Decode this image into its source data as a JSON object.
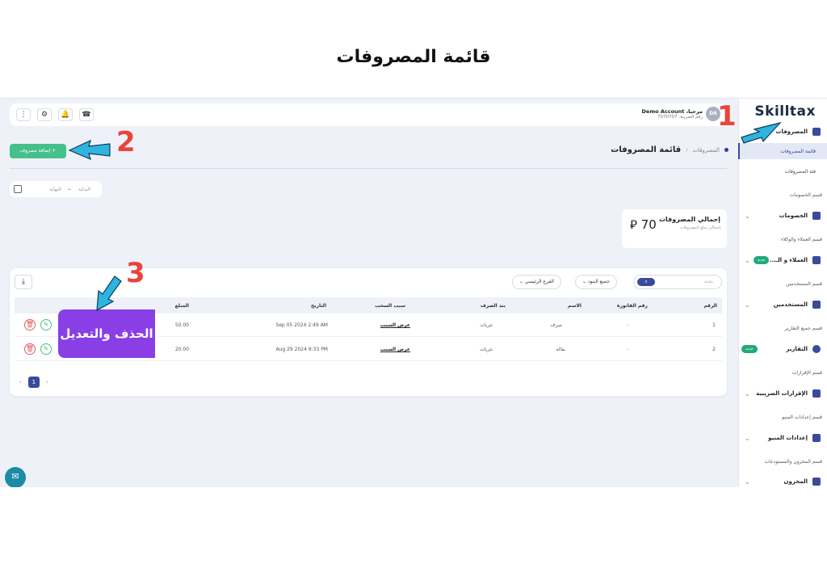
{
  "page_title": "قائمة المصروفات",
  "app": {
    "logo": "Skilltax",
    "user": {
      "avatar": "DA",
      "greeting": "مرحبا، Demo Account",
      "tax_number": "رقم الضريبة: 7070707"
    }
  },
  "topbar_icons": [
    "grid-icon",
    "settings-icon",
    "bell-icon",
    "support-icon"
  ],
  "sidebar": {
    "expenses": "المصروفات",
    "expenses_list": "قائمة المصروفات",
    "expenses_category": "فئة المصروفات",
    "section_discounts": "قسم الخصومات",
    "discounts": "الخصومات",
    "section_clients": "قسم العملاء والوكلاء",
    "clients": "العملاء و الـ...",
    "section_users": "قسم المستخدمين",
    "users": "المستخدمين",
    "section_reports": "قسم جميع التقارير",
    "reports": "التقارير",
    "section_returns": "قسم الإقرارات",
    "returns": "الإقرارات الضريبية",
    "section_menu": "قسم إعدادات المنيو",
    "menu_settings": "إعدادات المنيو",
    "section_inventory": "قسم المخزون والمستودعات",
    "inventory": "المخزون",
    "new_badge": "جديد"
  },
  "toolbar": {
    "add_expense": "+ إضافة مصروف"
  },
  "breadcrumb": {
    "parent": "المصروفات",
    "separator": "/",
    "current": "قائمة المصروفات"
  },
  "date_filter": {
    "start": "البداية",
    "arrow": "←",
    "end": "النهاية"
  },
  "summary": {
    "title": "إجمالي المصروفات",
    "subtitle": "إجمالي مبلغ المصروفات",
    "value": "70",
    "currency": "⃁"
  },
  "table": {
    "search_placeholder": "بحث",
    "filter_items": "جميع البنود",
    "filter_branch": "الفرع الرئيسي",
    "headers": [
      "الرقم",
      "رقم الفاتورة",
      "الاسم",
      "بند الصرف",
      "سبب السحب",
      "التاريخ",
      "المبلغ"
    ],
    "rows": [
      {
        "no": "1",
        "invoice": "-",
        "name": "صرف",
        "item": "نثريات",
        "reason": "عرض السبب",
        "date": "Sep 05 2024 2:49 AM",
        "amount": "50.00"
      },
      {
        "no": "2",
        "invoice": "-",
        "name": "بقالة",
        "item": "نثريات",
        "reason": "عرض السبب",
        "date": "Aug 29 2024 9:33 PM",
        "amount": "20.00"
      }
    ],
    "page": "1"
  },
  "annotations": {
    "n1": "1",
    "n2": "2",
    "n3": "3",
    "delete_edit_label": "الحذف والتعديل"
  },
  "colors": {
    "accent": "#3b4a9a",
    "green": "#45c08a",
    "red_annotation": "#e8443a",
    "arrow": "#2fb4e0",
    "purple": "#8a3ee6"
  }
}
